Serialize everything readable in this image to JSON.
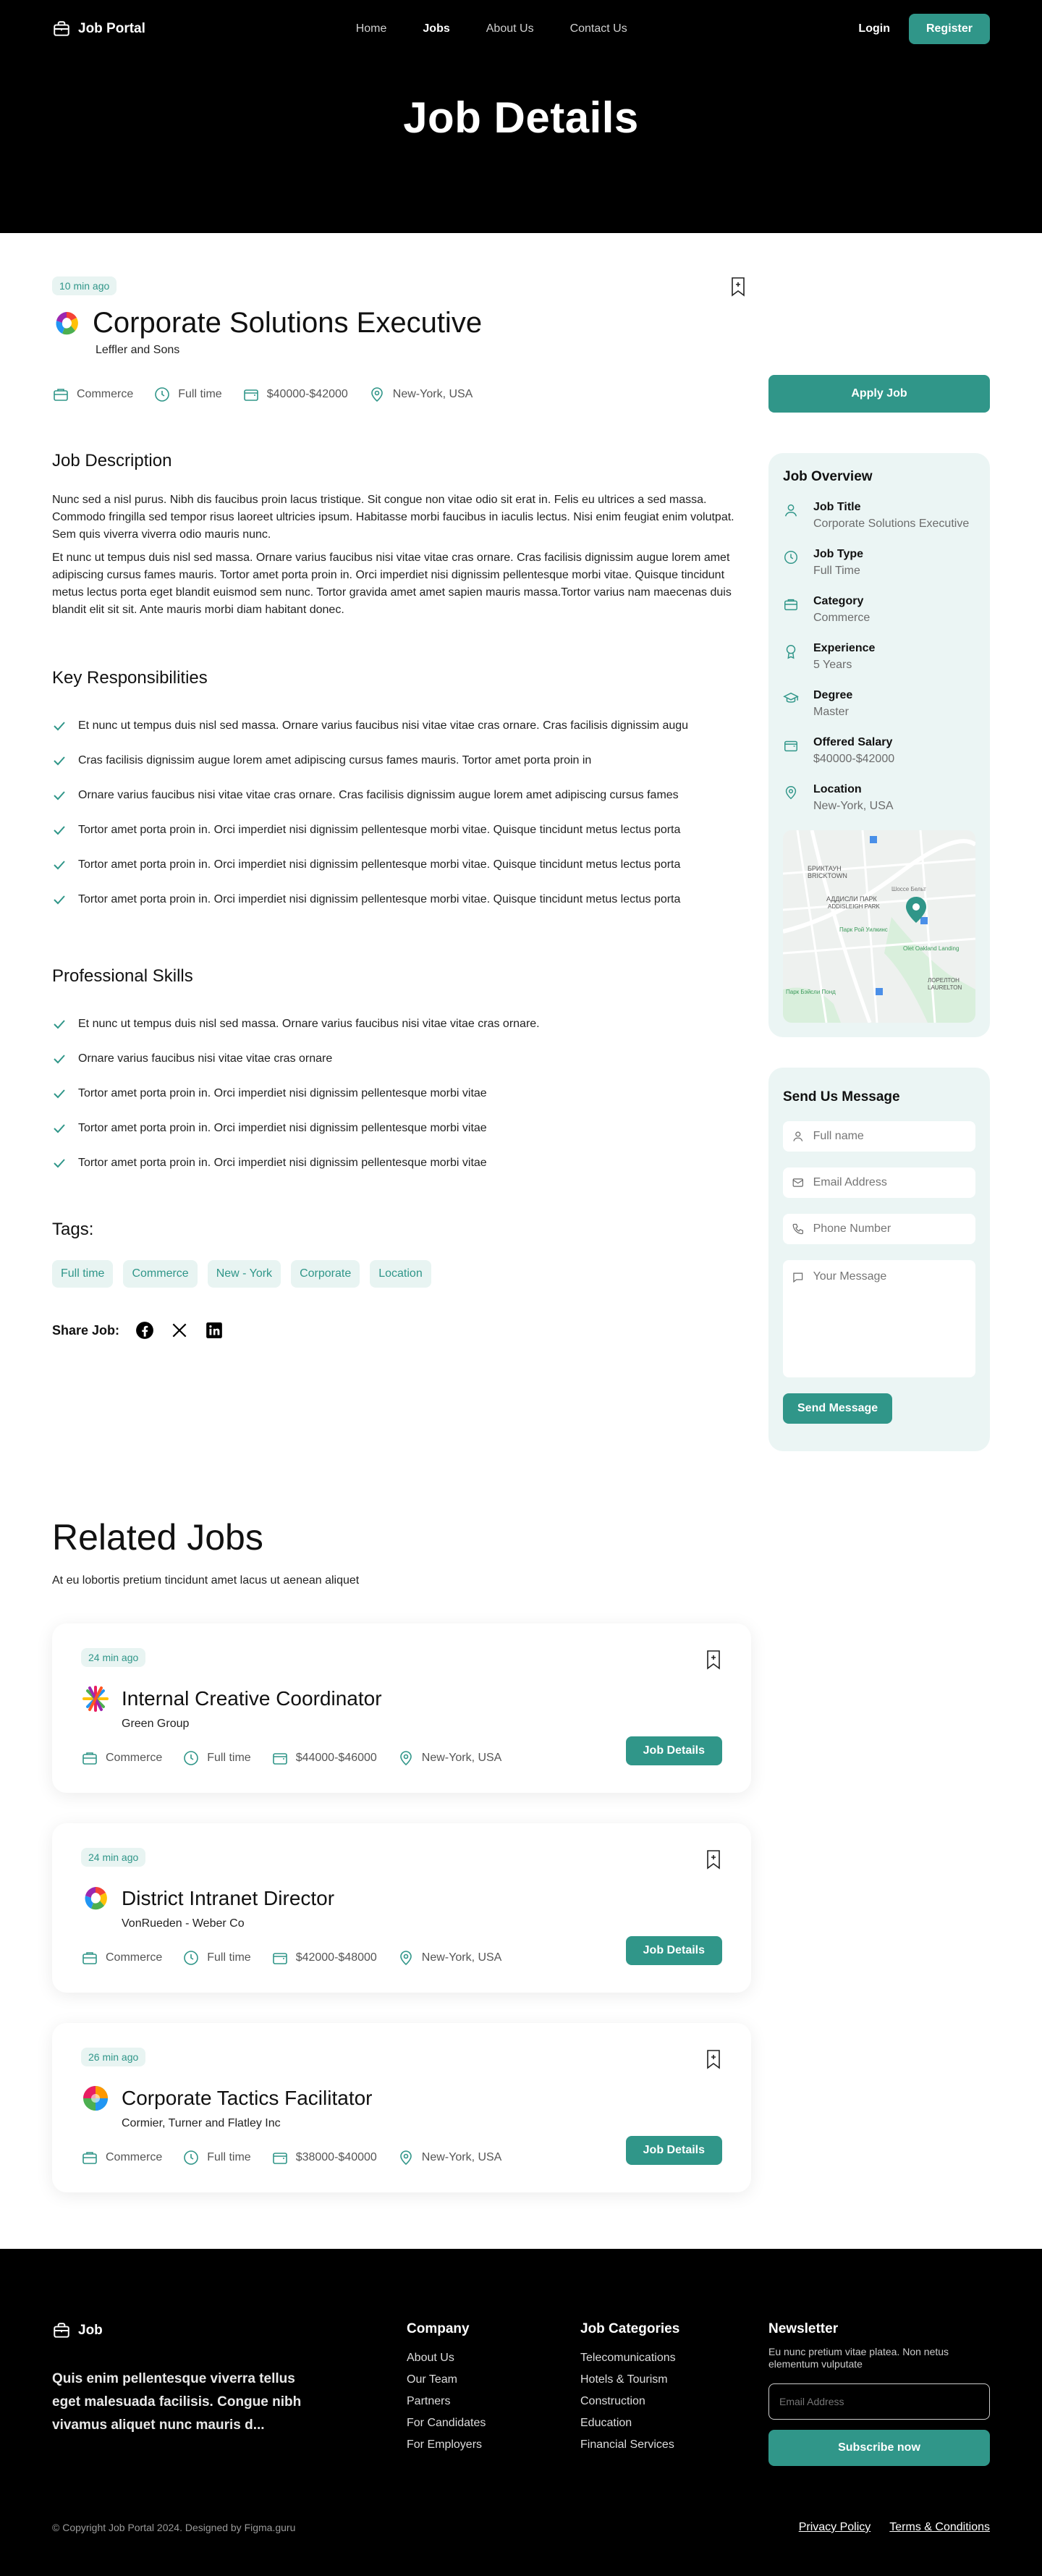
{
  "nav": {
    "brand": "Job Portal",
    "links": [
      "Home",
      "Jobs",
      "About Us",
      "Contact Us"
    ],
    "login": "Login",
    "register": "Register"
  },
  "hero": {
    "title": "Job Details"
  },
  "job": {
    "posted": "10 min ago",
    "title": "Corporate Solutions Executive",
    "company": "Leffler and Sons",
    "category": "Commerce",
    "type": "Full time",
    "salary": "$40000-$42000",
    "location": "New-York, USA",
    "apply": "Apply Job"
  },
  "description": {
    "heading": "Job Description",
    "p1": "Nunc sed a nisl purus. Nibh dis faucibus proin lacus tristique. Sit congue non vitae odio sit erat in. Felis eu ultrices a sed massa. Commodo fringilla sed tempor risus laoreet ultricies ipsum. Habitasse morbi faucibus in iaculis lectus. Nisi enim feugiat enim volutpat. Sem quis viverra viverra odio mauris nunc.",
    "p2": "Et nunc ut tempus duis nisl sed massa. Ornare varius faucibus nisi vitae vitae cras ornare. Cras facilisis dignissim augue lorem amet adipiscing cursus fames mauris. Tortor amet porta proin in. Orci imperdiet nisi dignissim pellentesque morbi vitae. Quisque tincidunt metus lectus porta eget blandit euismod sem nunc. Tortor gravida amet amet sapien mauris massa.Tortor varius nam maecenas duis blandit elit sit sit. Ante mauris morbi diam habitant donec."
  },
  "responsibilities": {
    "heading": "Key Responsibilities",
    "items": [
      "Et nunc ut tempus duis nisl sed massa. Ornare varius faucibus nisi vitae vitae cras ornare. Cras facilisis dignissim augu",
      "Cras facilisis dignissim augue lorem amet adipiscing cursus fames mauris. Tortor amet porta proin in",
      "Ornare varius faucibus nisi vitae vitae cras ornare. Cras facilisis dignissim augue lorem amet adipiscing cursus fames",
      "Tortor amet porta proin in. Orci imperdiet nisi dignissim pellentesque morbi vitae. Quisque tincidunt metus lectus porta",
      "Tortor amet porta proin in. Orci imperdiet nisi dignissim pellentesque morbi vitae. Quisque tincidunt metus lectus porta",
      "Tortor amet porta proin in. Orci imperdiet nisi dignissim pellentesque morbi vitae. Quisque tincidunt metus lectus porta"
    ]
  },
  "skills": {
    "heading": "Professional Skills",
    "items": [
      "Et nunc ut tempus duis nisl sed massa. Ornare varius faucibus nisi vitae vitae cras ornare.",
      "Ornare varius faucibus nisi vitae vitae cras ornare",
      "Tortor amet porta proin in. Orci imperdiet nisi dignissim pellentesque morbi vitae",
      "Tortor amet porta proin in. Orci imperdiet nisi dignissim pellentesque morbi vitae",
      "Tortor amet porta proin in. Orci imperdiet nisi dignissim pellentesque morbi vitae"
    ]
  },
  "tags": {
    "heading": "Tags:",
    "items": [
      "Full time",
      "Commerce",
      "New - York",
      "Corporate",
      "Location"
    ]
  },
  "share": {
    "label": "Share Job:"
  },
  "overview": {
    "heading": "Job Overview",
    "items": [
      {
        "label": "Job Title",
        "value": "Corporate Solutions Executive"
      },
      {
        "label": "Job Type",
        "value": "Full Time"
      },
      {
        "label": "Category",
        "value": "Commerce"
      },
      {
        "label": "Experience",
        "value": "5 Years"
      },
      {
        "label": "Degree",
        "value": "Master"
      },
      {
        "label": "Offered Salary",
        "value": "$40000-$42000"
      },
      {
        "label": "Location",
        "value": "New-York, USA"
      }
    ],
    "map_labels": [
      "БРИКТАУН",
      "BRICKTOWN",
      "АДДИСЛИ ПАРК",
      "ADDISLEIGH PARK",
      "Парк Рой Уилкинс",
      "ЛОРЕЛТОН",
      "LAURELTON",
      "Парк Бэйсли Понд",
      "Шоссе Бельт",
      "Olet Oakland Landing"
    ]
  },
  "message": {
    "heading": "Send Us Message",
    "name_ph": "Full name",
    "email_ph": "Email Address",
    "phone_ph": "Phone Number",
    "msg_ph": "Your Message",
    "send": "Send Message"
  },
  "related": {
    "heading": "Related Jobs",
    "sub": "At eu lobortis pretium tincidunt amet lacus ut aenean aliquet",
    "button": "Job Details",
    "jobs": [
      {
        "posted": "24 min ago",
        "title": "Internal Creative Coordinator",
        "company": "Green Group",
        "category": "Commerce",
        "type": "Full time",
        "salary": "$44000-$46000",
        "location": "New-York, USA"
      },
      {
        "posted": "24 min ago",
        "title": "District Intranet Director",
        "company": "VonRueden - Weber Co",
        "category": "Commerce",
        "type": "Full time",
        "salary": "$42000-$48000",
        "location": "New-York, USA"
      },
      {
        "posted": "26 min ago",
        "title": "Corporate Tactics Facilitator",
        "company": "Cormier, Turner and Flatley Inc",
        "category": "Commerce",
        "type": "Full time",
        "salary": "$38000-$40000",
        "location": "New-York, USA"
      }
    ]
  },
  "footer": {
    "brand": "Job",
    "tagline": "Quis enim pellentesque viverra tellus eget malesuada facilisis. Congue nibh vivamus aliquet nunc mauris d...",
    "company_heading": "Company",
    "company_links": [
      "About Us",
      "Our Team",
      "Partners",
      "For Candidates",
      "For Employers"
    ],
    "categories_heading": "Job Categories",
    "categories": [
      "Telecomunications",
      "Hotels & Tourism",
      "Construction",
      "Education",
      "Financial Services"
    ],
    "newsletter_heading": "Newsletter",
    "newsletter_text": "Eu nunc pretium vitae platea. Non netus elementum vulputate",
    "email_ph": "Email Address",
    "subscribe": "Subscribe now",
    "copyright": "© Copyright Job Portal  2024. Designed by Figma.guru",
    "privacy": "Privacy Policy",
    "terms": "Terms & Conditions"
  },
  "colors": {
    "accent": "#309689",
    "tint": "#ebf5f4",
    "dark": "#000000"
  }
}
